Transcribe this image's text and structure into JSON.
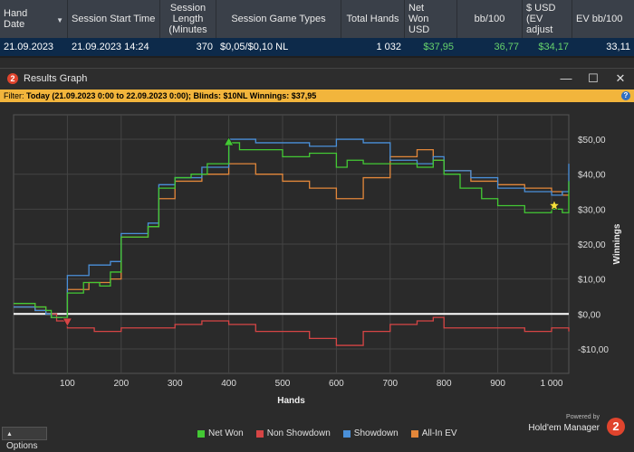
{
  "report": {
    "columns": [
      {
        "label": "Hand Date",
        "key": "hand_date"
      },
      {
        "label": "Session Start Time",
        "key": "start"
      },
      {
        "label": "Session Length (Minutes",
        "key": "length"
      },
      {
        "label": "Session Game Types",
        "key": "types"
      },
      {
        "label": "Total Hands",
        "key": "hands"
      },
      {
        "label": "Net Won USD",
        "key": "net"
      },
      {
        "label": "bb/100",
        "key": "bb100"
      },
      {
        "label": "$ USD (EV adjust",
        "key": "ev_usd"
      },
      {
        "label": "EV bb/100",
        "key": "ev_bb"
      }
    ],
    "row": {
      "hand_date": "21.09.2023",
      "start": "21.09.2023 14:24",
      "length": "370",
      "types": "$0,05/$0,10 NL",
      "hands": "1 032",
      "net": "$37,95",
      "bb100": "36,77",
      "ev_usd": "$34,17",
      "ev_bb": "33,11"
    }
  },
  "window": {
    "badge": "2",
    "title": "Results Graph",
    "minimize": "—",
    "maximize": "☐",
    "close": "✕"
  },
  "filter": {
    "label": "Filter:",
    "text": "Today (21.09.2023 0:00 to 22.09.2023 0:00); Blinds: $10NL Winnings: $37,95",
    "info": "?"
  },
  "options_label": "Options",
  "brand": {
    "powered": "Powered by",
    "name": "Hold'em Manager",
    "logo": "2"
  },
  "colors": {
    "net_won": "#43c934",
    "non_showdown": "#d64545",
    "showdown": "#4a90d9",
    "all_in_ev": "#e3873a",
    "accent": "#f2b53c"
  },
  "chart_data": {
    "type": "line",
    "xlabel": "Hands",
    "ylabel": "Winnings",
    "xlim": [
      0,
      1032
    ],
    "ylim": [
      -17,
      57
    ],
    "xticks": [
      100,
      200,
      300,
      400,
      500,
      600,
      700,
      800,
      900,
      1000
    ],
    "xtick_labels": [
      "100",
      "200",
      "300",
      "400",
      "500",
      "600",
      "700",
      "800",
      "900",
      "1 000"
    ],
    "yticks": [
      -10,
      0,
      10,
      20,
      30,
      40,
      50
    ],
    "ytick_labels": [
      "-$10,00",
      "$0,00",
      "$10,00",
      "$20,00",
      "$30,00",
      "$40,00",
      "$50,00"
    ],
    "grid": true,
    "legend_position": "bottom",
    "series": [
      {
        "name": "Net Won",
        "color": "#43c934",
        "x": [
          0,
          40,
          60,
          70,
          100,
          130,
          160,
          180,
          200,
          250,
          270,
          300,
          330,
          360,
          400,
          420,
          450,
          500,
          550,
          600,
          620,
          650,
          700,
          750,
          780,
          800,
          830,
          870,
          900,
          950,
          1000,
          1020,
          1032
        ],
        "y": [
          3,
          2,
          1,
          -1,
          6,
          9,
          8,
          12,
          22,
          25,
          36,
          39,
          40,
          43,
          49,
          47,
          47,
          45,
          46,
          42,
          44,
          43,
          43,
          42,
          44,
          40,
          36,
          33,
          31,
          29,
          30,
          29,
          38
        ]
      },
      {
        "name": "Non Showdown",
        "color": "#d64545",
        "x": [
          0,
          40,
          60,
          80,
          100,
          150,
          200,
          250,
          300,
          350,
          400,
          450,
          500,
          550,
          600,
          650,
          700,
          750,
          780,
          800,
          850,
          900,
          950,
          1000,
          1032
        ],
        "y": [
          3,
          2,
          0,
          -2,
          -4,
          -5,
          -4,
          -4,
          -3,
          -2,
          -3,
          -5,
          -5,
          -7,
          -9,
          -5,
          -3,
          -2,
          -1,
          -4,
          -4,
          -4,
          -5,
          -4,
          -5
        ]
      },
      {
        "name": "Showdown",
        "color": "#4a90d9",
        "x": [
          0,
          40,
          60,
          70,
          100,
          140,
          180,
          200,
          250,
          270,
          300,
          350,
          400,
          450,
          500,
          550,
          600,
          650,
          700,
          750,
          780,
          800,
          850,
          900,
          950,
          1000,
          1020,
          1032
        ],
        "y": [
          2,
          1,
          0,
          -1,
          11,
          14,
          15,
          23,
          26,
          37,
          39,
          42,
          50,
          49,
          49,
          48,
          50,
          49,
          44,
          43,
          45,
          41,
          39,
          36,
          35,
          34,
          35,
          43
        ]
      },
      {
        "name": "All-In EV",
        "color": "#e3873a",
        "x": [
          0,
          40,
          60,
          70,
          100,
          140,
          180,
          200,
          250,
          270,
          300,
          350,
          400,
          450,
          500,
          550,
          600,
          650,
          700,
          750,
          780,
          800,
          850,
          900,
          950,
          1000,
          1020,
          1032
        ],
        "y": [
          2,
          1,
          0,
          -1,
          7,
          9,
          10,
          22,
          25,
          33,
          38,
          40,
          43,
          40,
          38,
          36,
          33,
          39,
          45,
          47,
          44,
          41,
          38,
          37,
          36,
          35,
          34,
          34
        ]
      }
    ],
    "markers": [
      {
        "type": "triangle-up",
        "x": 400,
        "y": 49,
        "color": "#43c934"
      },
      {
        "type": "triangle-down",
        "x": 100,
        "y": -2,
        "color": "#d64545"
      },
      {
        "type": "star",
        "x": 1005,
        "y": 31,
        "color": "#f5e03a"
      }
    ]
  }
}
